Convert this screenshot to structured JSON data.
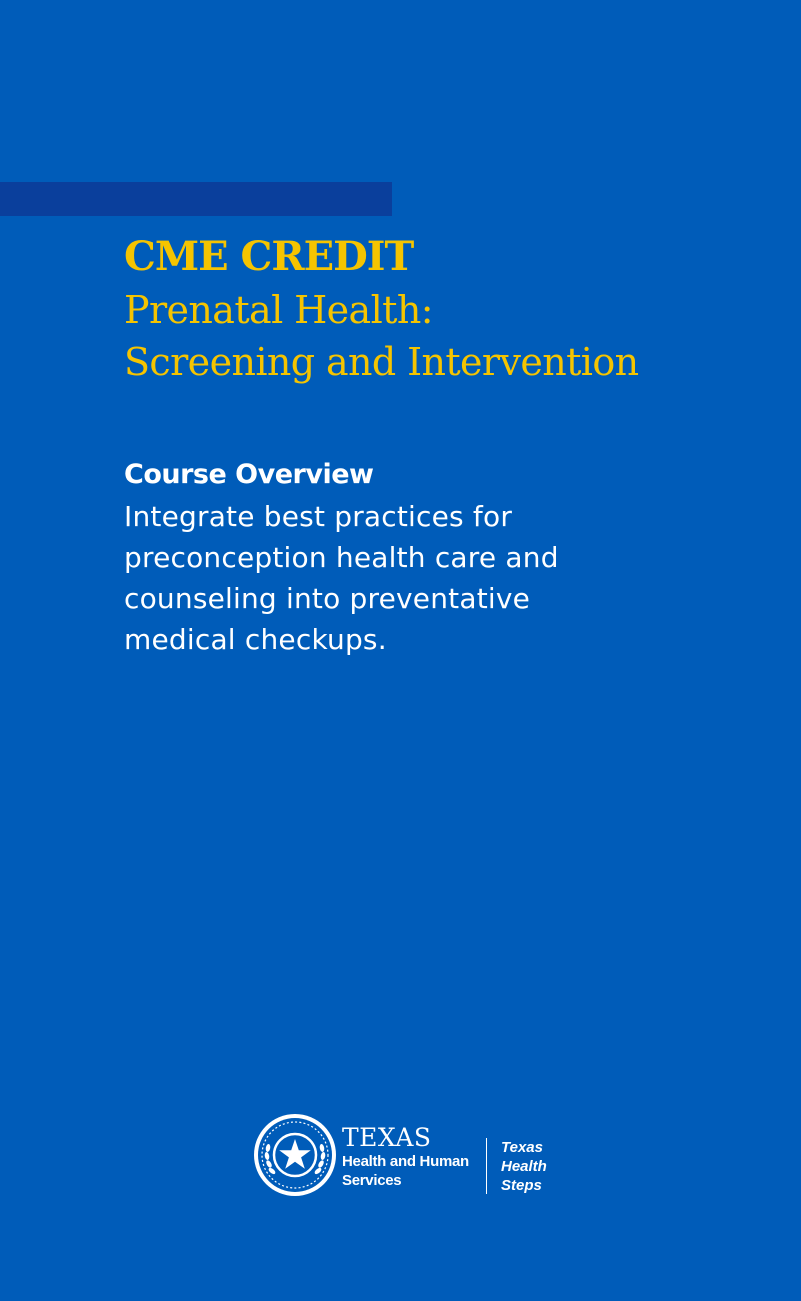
{
  "header": {
    "kicker": "CME CREDIT",
    "title_line_1": "Prenatal Health:",
    "title_line_2": "Screening and Intervention"
  },
  "overview": {
    "heading": "Course Overview",
    "body": "Integrate best practices for preconception health care and counseling into preventative medical checkups."
  },
  "footer": {
    "hhs": {
      "texas": "TEXAS",
      "line_1": "Health and Human",
      "line_2": "Services"
    },
    "ths": {
      "line_1": "Texas",
      "line_2": "Health",
      "line_3": "Steps"
    }
  },
  "colors": {
    "background": "#005cb9",
    "accent_bar": "#0a3f9c",
    "headline": "#f5c400",
    "text": "#ffffff"
  }
}
